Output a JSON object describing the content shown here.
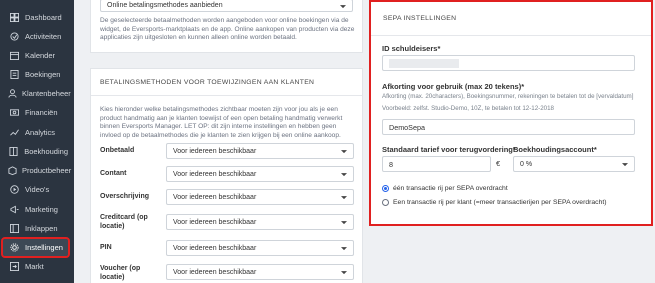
{
  "sidebar": {
    "items": [
      {
        "label": "Dashboard",
        "icon": "dashboard-icon"
      },
      {
        "label": "Activiteiten",
        "icon": "activities-icon"
      },
      {
        "label": "Kalender",
        "icon": "calendar-icon"
      },
      {
        "label": "Boekingen",
        "icon": "bookings-icon"
      },
      {
        "label": "Klantenbeheer",
        "icon": "customers-icon"
      },
      {
        "label": "Financiën",
        "icon": "finance-icon"
      },
      {
        "label": "Analytics",
        "icon": "analytics-icon"
      },
      {
        "label": "Boekhouding",
        "icon": "accounting-icon"
      },
      {
        "label": "Productbeheer",
        "icon": "products-icon"
      },
      {
        "label": "Video's",
        "icon": "video-icon"
      },
      {
        "label": "Marketing",
        "icon": "marketing-icon"
      },
      {
        "label": "Inklappen",
        "icon": "collapse-icon"
      },
      {
        "label": "Instellingen",
        "icon": "gear-icon"
      },
      {
        "label": "Markt",
        "icon": "market-icon"
      }
    ],
    "active_index": 12,
    "highlight_color": "#e02020"
  },
  "online_card": {
    "select_value": "Online betalingsmethodes aanbieden",
    "description": "De geselecteerde betaalmethoden worden aangeboden voor online boekingen via de widget, de Eversports-marktplaats en de app. Online aankopen van producten via deze applicaties zijn uitgesloten en kunnen alleen online worden betaald."
  },
  "assign_card": {
    "title": "BETALINGSMETHODEN VOOR TOEWIJZINGEN AAN KLANTEN",
    "description": "Kies hieronder welke betalingsmethodes zichtbaar moeten zijn voor jou als je een product handmatig aan je klanten toewijst of een open betaling handmatig verwerkt binnen Eversports Manager. LET OP: dit zijn interne instellingen en hebben geen invloed op de betaalmethodes die je klanten te zien krijgen bij een online aankoop.",
    "methods": [
      {
        "label": "Onbetaald",
        "value": "Voor iedereen beschikbaar"
      },
      {
        "label": "Contant",
        "value": "Voor iedereen beschikbaar"
      },
      {
        "label": "Overschrijving",
        "value": "Voor iedereen beschikbaar"
      },
      {
        "label": "Creditcard (op locatie)",
        "value": "Voor iedereen beschikbaar"
      },
      {
        "label": "PIN",
        "value": "Voor iedereen beschikbaar"
      },
      {
        "label": "Voucher (op locatie)",
        "value": "Voor iedereen beschikbaar"
      }
    ]
  },
  "sepa": {
    "title": "SEPA INSTELLINGEN",
    "creditor_id_label": "ID schuldeisers*",
    "creditor_id_value": "",
    "abbrev_label": "Afkorting voor gebruik (max 20 tekens)*",
    "abbrev_hint": "Afkorting (max. 20characters), Boekingsnummer, rekeningen te betalen tot de [vervaldatum]",
    "abbrev_example": "Voorbeeld: zelfst. Studio-Demo, 10Z, te betalen tot 12-12-2018",
    "abbrev_value": "DemoSepa",
    "fee_label": "Standaard tarief voor terugvordering*",
    "fee_value": "8",
    "fee_currency": "€",
    "account_label": "Boekhoudingsaccount*",
    "account_value": "0 %",
    "radio_options": [
      {
        "label": "één transactie rij per SEPA overdracht",
        "selected": true
      },
      {
        "label": "Een transactie rij per klant (=meer transactierijen per SEPA overdracht)",
        "selected": false
      }
    ]
  }
}
